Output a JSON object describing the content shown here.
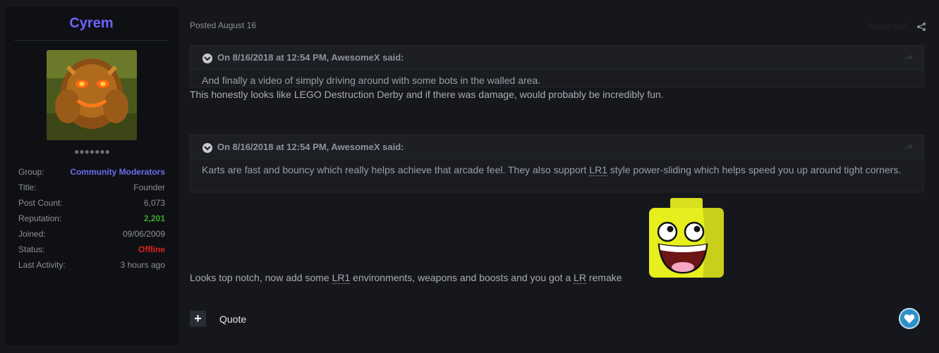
{
  "author": {
    "name": "Cyrem",
    "rank_dots": "●●●●●●●",
    "info": [
      {
        "label": "Group:",
        "value": "Community Moderators",
        "style": "mod"
      },
      {
        "label": "Title:",
        "value": "Founder",
        "style": "plain"
      },
      {
        "label": "Post Count:",
        "value": "6,073",
        "style": "plain"
      },
      {
        "label": "Reputation:",
        "value": "2,201",
        "style": "rep"
      },
      {
        "label": "Joined:",
        "value": "09/06/2009",
        "style": "plain"
      },
      {
        "label": "Status:",
        "value": "Offline",
        "style": "off"
      },
      {
        "label": "Last Activity:",
        "value": "3 hours ago",
        "style": "plain"
      }
    ]
  },
  "post": {
    "posted": "Posted August 16",
    "report": "Report post",
    "quote1": {
      "cite": "On 8/16/2018 at 12:54 PM, AwesomeX said:",
      "body": "And finally a video of simply driving around with some bots in the walled area."
    },
    "reply1": "This honestly looks like LEGO Destruction Derby and if there was damage, would probably be incredibly fun.",
    "quote2": {
      "cite": "On 8/16/2018 at 12:54 PM, AwesomeX said:",
      "body_pre": "Karts are fast and bouncy which really helps achieve that arcade feel. They also support ",
      "body_abbr": "LR1",
      "body_post": " style power-sliding which helps speed you up around tight corners."
    },
    "reply2": {
      "pre": "Looks top notch, now add some ",
      "abbr1": "LR1",
      "mid": " environments, weapons and boosts and you got a ",
      "abbr2": "LR",
      "post": " remake"
    },
    "plus_label": "+",
    "quote_label": "Quote"
  },
  "colors": {
    "accent": "#6c63ff",
    "reputation": "#3fa535",
    "offline": "#e0221f",
    "like": "#2f8fc9"
  },
  "icons": [
    "share-icon",
    "chevron-down-icon",
    "link-arrow-icon",
    "plus-icon",
    "heart-icon",
    "awesome-face-emoji"
  ]
}
